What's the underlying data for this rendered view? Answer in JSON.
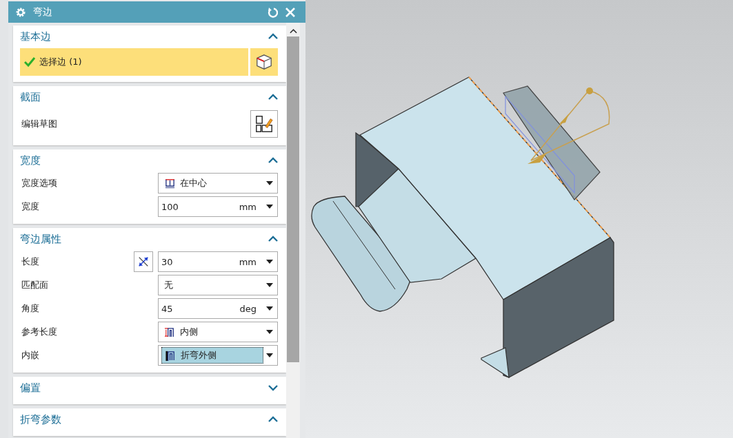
{
  "window": {
    "title": "弯边"
  },
  "sections": [
    {
      "title": "基本边",
      "expanded": true,
      "rows": [
        {
          "kind": "select",
          "label": "选择边 (1)",
          "checked": true
        }
      ]
    },
    {
      "title": "截面",
      "expanded": true,
      "rows": [
        {
          "kind": "sketch",
          "label": "编辑草图"
        }
      ]
    },
    {
      "title": "宽度",
      "expanded": true,
      "rows": [
        {
          "kind": "dropdown",
          "label": "宽度选项",
          "value": "在中心",
          "focused": false
        },
        {
          "kind": "value",
          "label": "宽度",
          "value": "100",
          "unit": "mm"
        }
      ]
    },
    {
      "title": "弯边属性",
      "expanded": true,
      "rows": [
        {
          "kind": "value",
          "label": "长度",
          "value": "30",
          "unit": "mm",
          "reverse": true
        },
        {
          "kind": "dropdown",
          "label": "匹配面",
          "value": "无",
          "focused": false
        },
        {
          "kind": "value",
          "label": "角度",
          "value": "45",
          "unit": "deg"
        },
        {
          "kind": "dropdown",
          "label": "参考长度",
          "value": "内侧",
          "focused": false
        },
        {
          "kind": "dropdown",
          "label": "内嵌",
          "value": "折弯外侧",
          "focused": true
        }
      ]
    },
    {
      "title": "偏置",
      "expanded": false
    },
    {
      "title": "折弯参数",
      "expanded": true
    }
  ]
}
